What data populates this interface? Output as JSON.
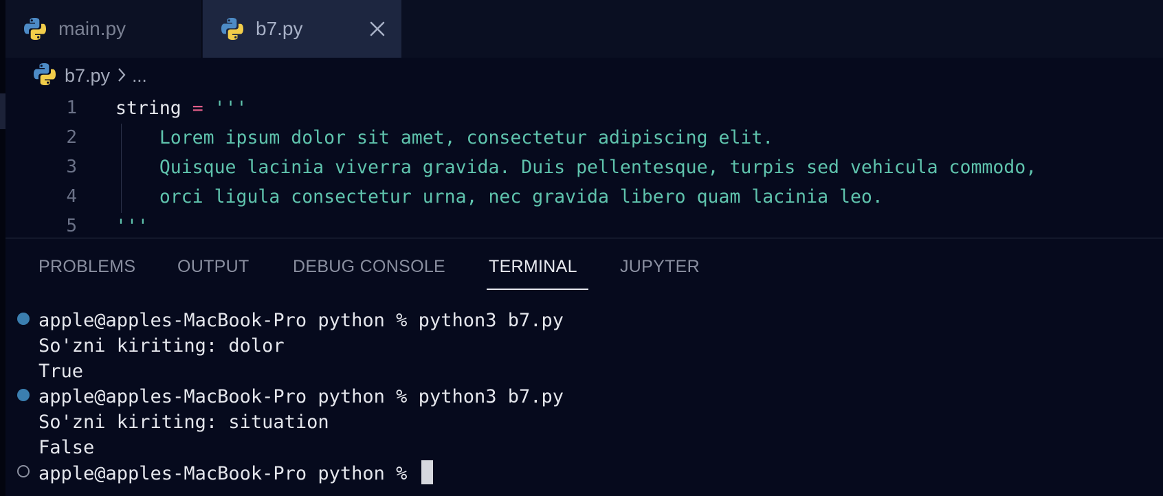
{
  "tabs": [
    {
      "label": "main.py",
      "icon": "python-icon",
      "active": false
    },
    {
      "label": "b7.py",
      "icon": "python-icon",
      "active": true
    }
  ],
  "breadcrumb": {
    "file": "b7.py",
    "more": "..."
  },
  "editor": {
    "lines": [
      {
        "number": "1",
        "parts": [
          [
            "string ",
            "#e6e8ee"
          ],
          [
            "=",
            "#e05d88"
          ],
          [
            " '''",
            "#5fc3ad"
          ]
        ]
      },
      {
        "number": "2",
        "parts": [
          [
            "    Lorem ipsum dolor sit amet, consectetur adipiscing elit.",
            "#5fc3ad"
          ]
        ]
      },
      {
        "number": "3",
        "parts": [
          [
            "    Quisque lacinia viverra gravida. Duis pellentesque, turpis sed vehicula commodo,",
            "#5fc3ad"
          ]
        ]
      },
      {
        "number": "4",
        "parts": [
          [
            "    orci ligula consectetur urna, nec gravida libero quam lacinia leo.",
            "#5fc3ad"
          ]
        ]
      },
      {
        "number": "5",
        "parts": [
          [
            "'''",
            "#5fc3ad"
          ]
        ]
      }
    ]
  },
  "panel": {
    "tabs": [
      "PROBLEMS",
      "OUTPUT",
      "DEBUG CONSOLE",
      "TERMINAL",
      "JUPYTER"
    ],
    "active_tab": "TERMINAL"
  },
  "terminal": {
    "lines": [
      {
        "text": "apple@apples-MacBook-Pro python % python3 b7.py",
        "marker": "filled"
      },
      {
        "text": "So'zni kiriting: dolor",
        "marker": ""
      },
      {
        "text": "True",
        "marker": ""
      },
      {
        "text": "apple@apples-MacBook-Pro python % python3 b7.py",
        "marker": "filled"
      },
      {
        "text": "So'zni kiriting: situation",
        "marker": ""
      },
      {
        "text": "False",
        "marker": ""
      },
      {
        "text": "apple@apples-MacBook-Pro python % ",
        "marker": "hollow"
      }
    ]
  },
  "colors": {
    "background": "#060a1d",
    "string": "#5fc3ad",
    "operator": "#e05d88",
    "text": "#e6e8ee",
    "terminal_dot": "#3b7fb0"
  }
}
